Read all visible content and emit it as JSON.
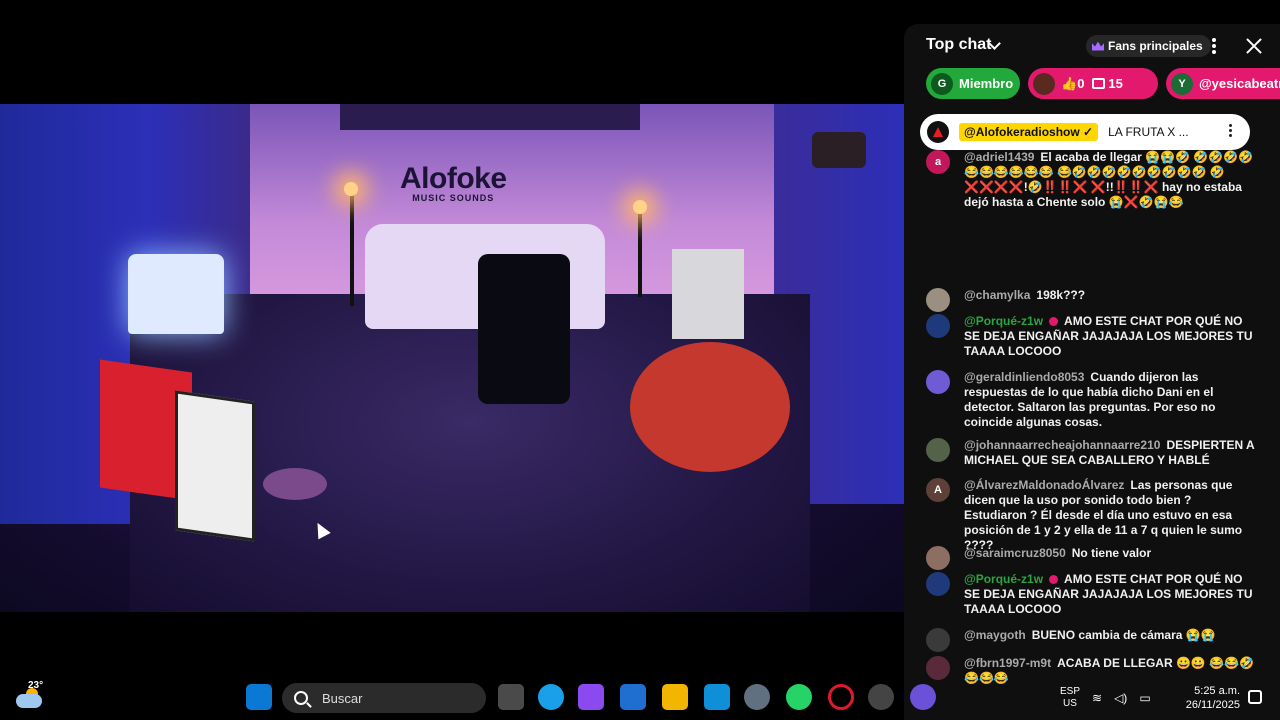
{
  "video": {
    "logo_main": "Alofoke",
    "logo_sub": "MUSIC SOUNDS"
  },
  "chat": {
    "title": "Top chat",
    "fans_label": "Fans principales",
    "pills": [
      {
        "avatar_letter": "G",
        "label": "Miembro"
      },
      {
        "likes": "0",
        "comments": "15"
      },
      {
        "avatar_letter": "Y",
        "label": "@yesicabeatr..."
      }
    ],
    "pinned": {
      "owner": "@Alofokeradioshow ✓",
      "message": "LA FRUTA X ..."
    },
    "messages": [
      {
        "avatar": "a",
        "avatar_color": "#c2185b",
        "author": "@adriel1439",
        "member": false,
        "text": "El acaba de llegar 😭😭🤣 🤣🤣🤣🤣😂😂😂😂😂😂 😂🤣🤣🤣🤣🤣🤣🤣🤣🤣 🤣❌❌❌❌!🤣‼️‼️❌ ❌!!‼️‼️❌ hay no estaba dejó hasta a Chente solo 😭❌🤣😭😂"
      },
      {
        "avatar": "",
        "avatar_color": "#9a8f80",
        "author": "@chamylka",
        "member": false,
        "text": "198k???"
      },
      {
        "avatar": "",
        "avatar_color": "#1f3a7a",
        "author": "@Porqué-z1w",
        "member": true,
        "mod": true,
        "text": "AMO ESTE CHAT POR QUÉ NO SE DEJA ENGAÑAR JAJAJAJA LOS MEJORES TU TAAAA LOCOOO"
      },
      {
        "avatar": "",
        "avatar_color": "#6f5bd6",
        "author": "@geraldinliendo8053",
        "member": false,
        "text": "Cuando dijeron las respuestas de lo que había dicho Dani en el detector. Saltaron las preguntas. Por eso no coincide algunas cosas."
      },
      {
        "avatar": "",
        "avatar_color": "#55624a",
        "author": "@johannaarrecheajohannaarre210",
        "member": false,
        "text": "DESPIERTEN A MICHAEL QUE SEA CABALLERO Y HABLÉ"
      },
      {
        "avatar": "A",
        "avatar_color": "#5d4037",
        "author": "@ÁlvarezMaldonadoÁlvarez",
        "member": false,
        "text": "Las personas que dicen que la uso por sonido todo bien ? Estudiaron ? Él desde el día uno estuvo en esa posición de 1 y 2 y ella de 11 a 7 q quien le sumo ????"
      },
      {
        "avatar": "",
        "avatar_color": "#8d6e63",
        "author": "@saraimcruz8050",
        "member": false,
        "text": "No tiene valor"
      },
      {
        "avatar": "",
        "avatar_color": "#1f3a7a",
        "author": "@Porqué-z1w",
        "member": true,
        "mod": true,
        "text": "AMO ESTE CHAT POR QUÉ NO SE DEJA ENGAÑAR JAJAJAJA LOS MEJORES TU TAAAA LOCOOO"
      },
      {
        "avatar": "",
        "avatar_color": "#3a3a3a",
        "author": "@maygoth",
        "member": false,
        "text": "BUENO cambia de cámara 😭😭"
      },
      {
        "avatar": "",
        "avatar_color": "#5a2a3a",
        "author": "@fbrn1997-m9t",
        "member": false,
        "text": "ACABA DE LLEGAR 😀😀 😂😂🤣😂😂😂"
      }
    ]
  },
  "taskbar": {
    "temperature": "23°",
    "search_placeholder": "Buscar",
    "lang_line1": "ESP",
    "lang_line2": "US",
    "time": "5:25 a.m.",
    "date": "26/11/2025"
  },
  "colors": {
    "chat_bg": "#0f0f0f",
    "member_green": "#2ba640",
    "pill_pink": "#e2196d",
    "pill_green": "#22a83b",
    "owner_badge": "#ffd600"
  }
}
